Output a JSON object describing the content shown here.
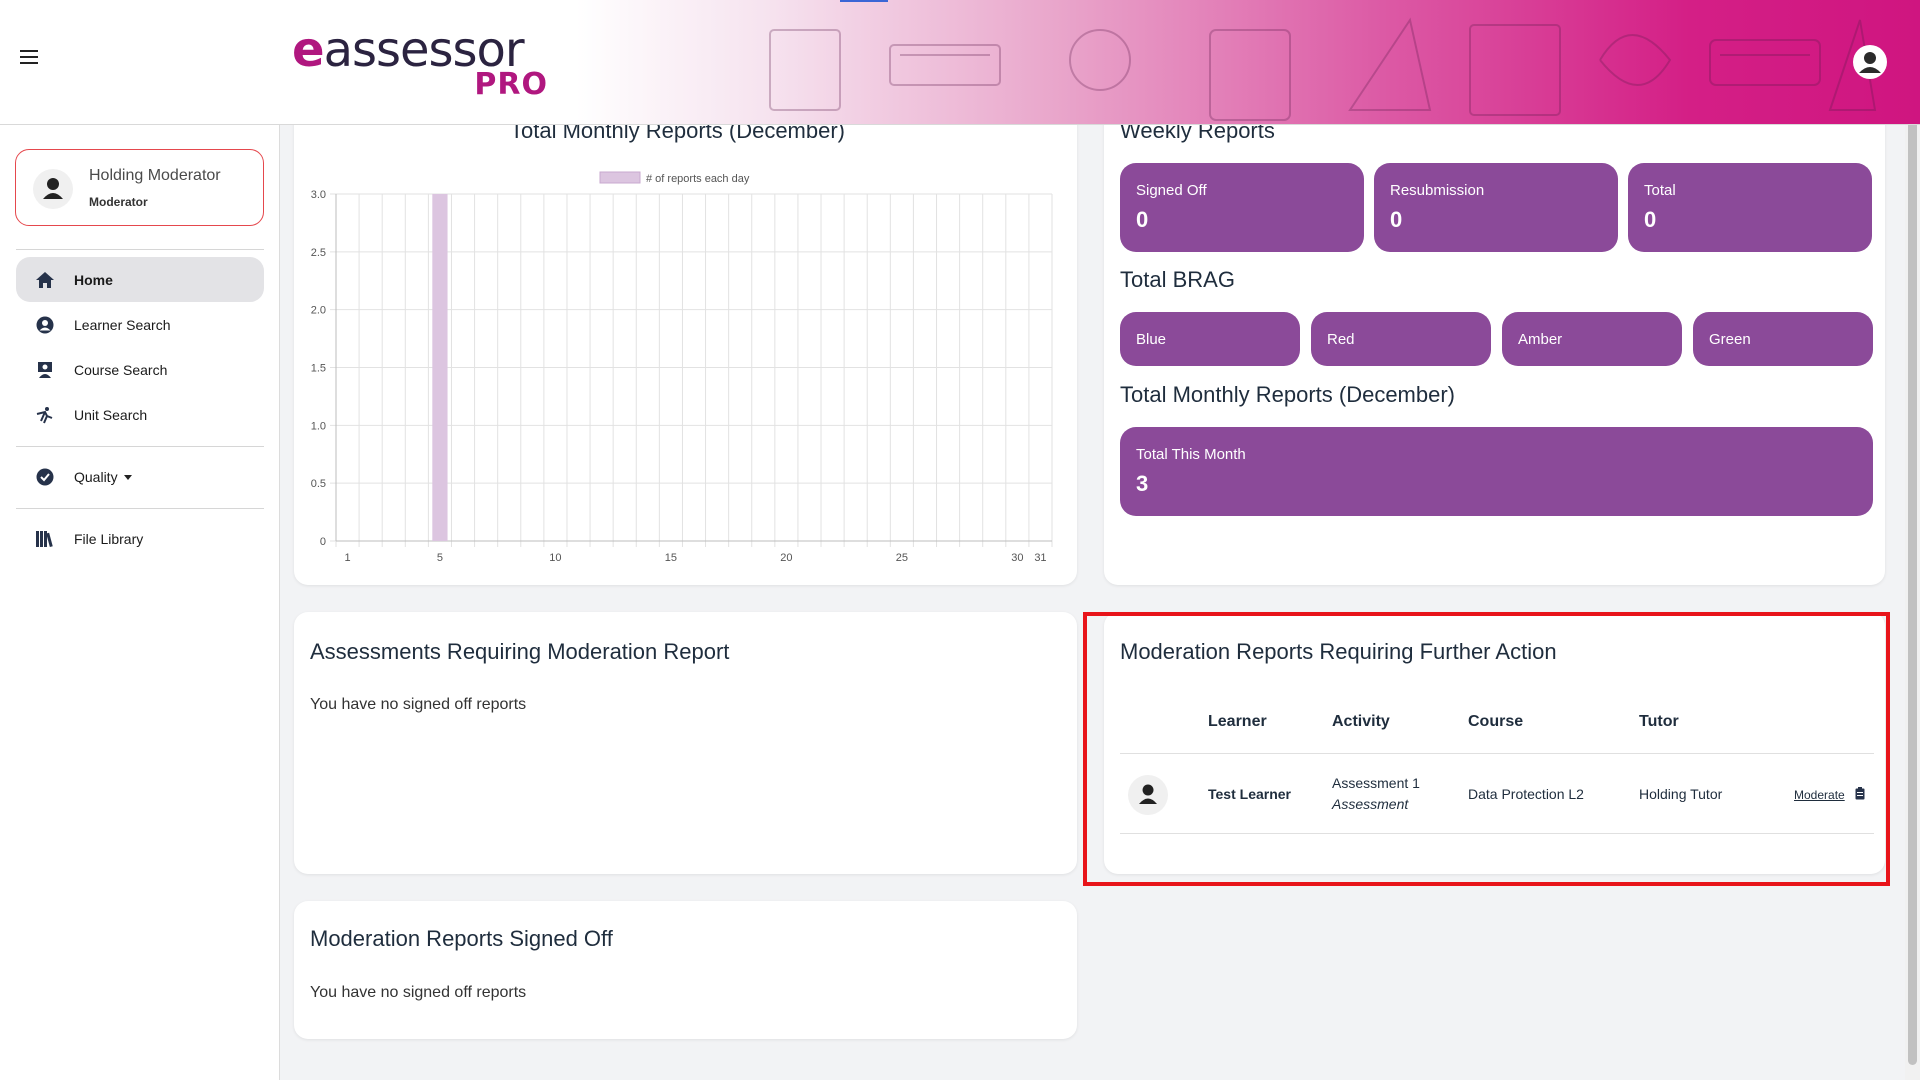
{
  "app": {
    "logo_word": "assessor",
    "logo_e": "e",
    "logo_pro": "PRO"
  },
  "profile": {
    "name": "Holding Moderator",
    "role": "Moderator"
  },
  "nav": {
    "items": [
      {
        "label": "Home",
        "icon": "home-icon"
      },
      {
        "label": "Learner Search",
        "icon": "user-circle-icon"
      },
      {
        "label": "Course Search",
        "icon": "course-icon"
      },
      {
        "label": "Unit Search",
        "icon": "unit-icon"
      },
      {
        "label": "Quality",
        "icon": "check-circle-icon"
      },
      {
        "label": "File Library",
        "icon": "library-icon"
      }
    ]
  },
  "chart_panel": {
    "title": "Total Monthly Reports (December)"
  },
  "chart_data": {
    "type": "bar",
    "title": "Total Monthly Reports (December)",
    "legend": [
      "# of reports each day"
    ],
    "legend_position": "top",
    "x": [
      1,
      2,
      3,
      4,
      5,
      6,
      7,
      8,
      9,
      10,
      11,
      12,
      13,
      14,
      15,
      16,
      17,
      18,
      19,
      20,
      21,
      22,
      23,
      24,
      25,
      26,
      27,
      28,
      29,
      30,
      31
    ],
    "x_tick_labels": [
      "1",
      "5",
      "10",
      "15",
      "20",
      "25",
      "30",
      "31"
    ],
    "series": [
      {
        "name": "# of reports each day",
        "values": [
          0,
          0,
          0,
          0,
          3,
          0,
          0,
          0,
          0,
          0,
          0,
          0,
          0,
          0,
          0,
          0,
          0,
          0,
          0,
          0,
          0,
          0,
          0,
          0,
          0,
          0,
          0,
          0,
          0,
          0,
          0
        ]
      }
    ],
    "ylim": [
      0,
      3.0
    ],
    "y_ticks": [
      "0",
      "0.5",
      "1.0",
      "1.5",
      "2.0",
      "2.5",
      "3.0"
    ],
    "grid": true,
    "bar_color": "#dcc5e0"
  },
  "weekly": {
    "heading": "Weekly Reports",
    "tiles": [
      {
        "label": "Signed Off",
        "value": "0"
      },
      {
        "label": "Resubmission",
        "value": "0"
      },
      {
        "label": "Total",
        "value": "0"
      }
    ]
  },
  "brag": {
    "heading": "Total BRAG",
    "tiles": [
      "Blue",
      "Red",
      "Amber",
      "Green"
    ]
  },
  "monthly": {
    "heading": "Total Monthly Reports (December)",
    "tile_label": "Total This Month",
    "tile_value": "3"
  },
  "assessments_panel": {
    "title": "Assessments Requiring Moderation Report",
    "empty_text": "You have no signed off reports"
  },
  "further_action_panel": {
    "title": "Moderation Reports Requiring Further Action",
    "columns": [
      "Learner",
      "Activity",
      "Course",
      "Tutor"
    ],
    "rows": [
      {
        "learner": "Test Learner",
        "activity": "Assessment 1",
        "activity_type": "Assessment",
        "course": "Data Protection L2",
        "tutor": "Holding Tutor",
        "action": "Moderate"
      }
    ]
  },
  "signed_off_panel": {
    "title": "Moderation Reports Signed Off",
    "empty_text": "You have no signed off reports"
  },
  "colors": {
    "accent": "#8b4a99",
    "brand": "#b0177f",
    "highlight": "#e8141a"
  }
}
